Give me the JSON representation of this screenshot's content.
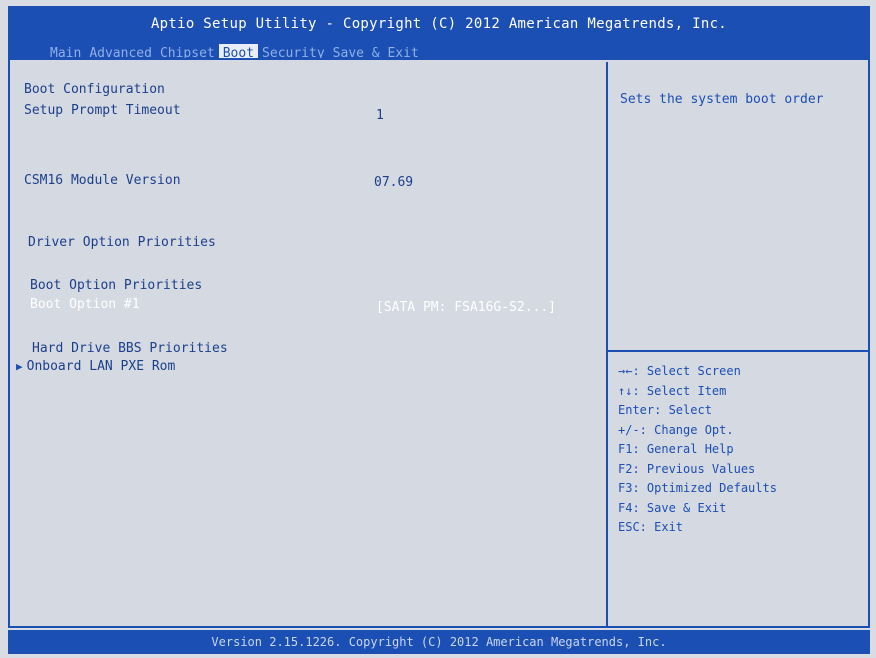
{
  "header": {
    "title": "Aptio Setup Utility - Copyright (C) 2012 American Megatrends, Inc.",
    "tabs": [
      "Main",
      "Advanced",
      "Chipset",
      "Boot",
      "Security",
      "Save & Exit"
    ],
    "active_tab": "Boot"
  },
  "main": {
    "boot_configuration": "Boot Configuration",
    "setup_prompt_timeout_label": "Setup Prompt Timeout",
    "setup_prompt_timeout_value": "1",
    "csm16_label": "CSM16 Module Version",
    "csm16_value": "07.69",
    "driver_option_priorities": "Driver Option Priorities",
    "boot_option_priorities": "Boot Option Priorities",
    "boot_option_1_label": "Boot Option #1",
    "boot_option_1_value": "[SATA  PM: FSA16G-S2...]",
    "hard_drive_bbs": "Hard Drive BBS Priorities",
    "onboard_lan_pxe": "Onboard LAN PXE Rom"
  },
  "help": {
    "text": "Sets the system boot order",
    "keys": [
      "→←: Select Screen",
      "↑↓: Select Item",
      "Enter: Select",
      "+/-: Change Opt.",
      "F1: General Help",
      "F2: Previous Values",
      "F3: Optimized Defaults",
      "F4: Save & Exit",
      "ESC: Exit"
    ]
  },
  "footer": {
    "text": "Version 2.15.1226. Copyright (C) 2012 American Megatrends, Inc."
  },
  "colors": {
    "bios_blue": "#1c4fb3",
    "panel_bg": "#d5d9e2",
    "text_blue": "#1c3f8a"
  }
}
